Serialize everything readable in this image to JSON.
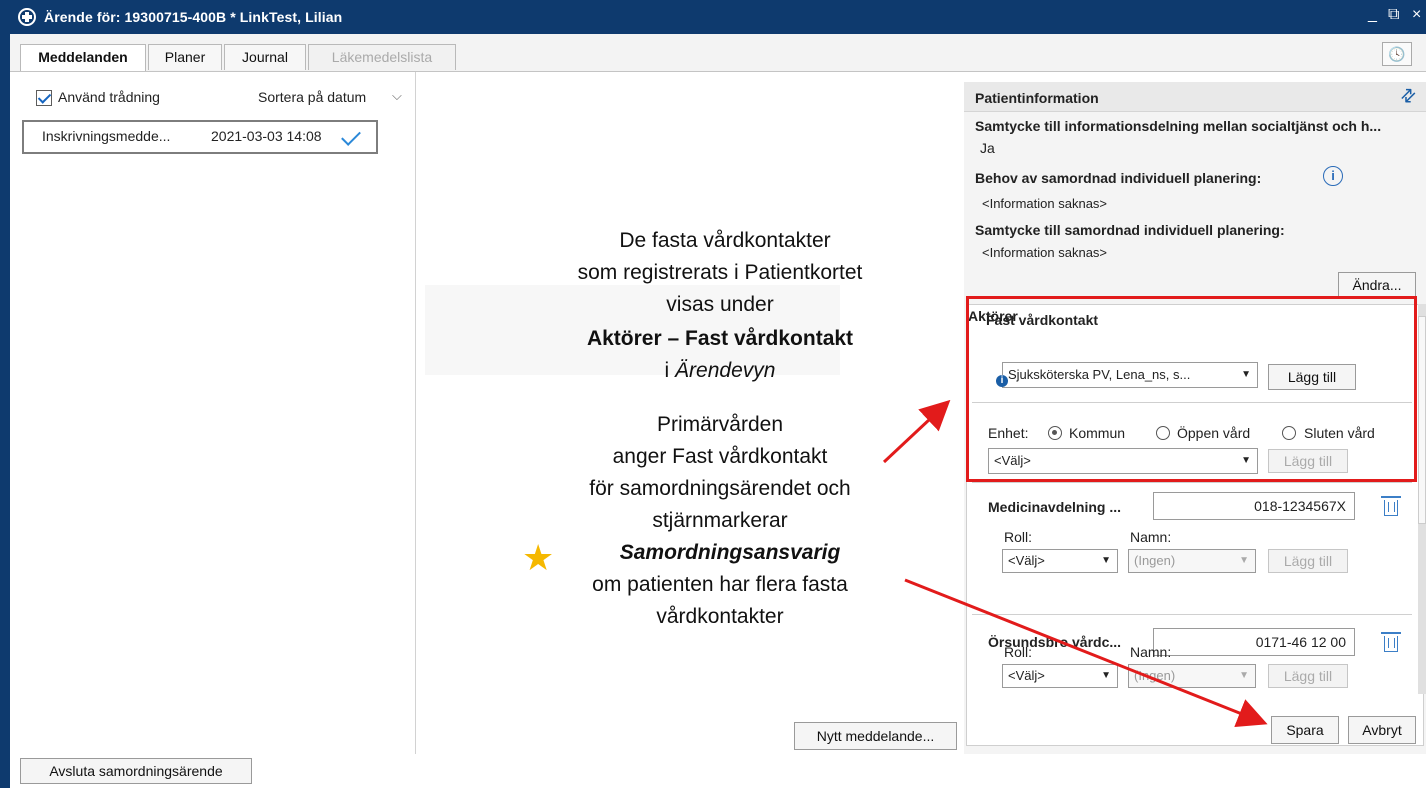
{
  "window": {
    "title": "Ärende för: 19300715-400B * LinkTest, Lilian",
    "controls": {
      "minimize": "_",
      "restore": "⧉",
      "close": "×"
    }
  },
  "tabs": [
    {
      "label": "Meddelanden",
      "state": "active"
    },
    {
      "label": "Planer",
      "state": "normal"
    },
    {
      "label": "Journal",
      "state": "normal"
    },
    {
      "label": "Läkemedelslista",
      "state": "disabled"
    }
  ],
  "messages": {
    "use_threading_label": "Använd trådning",
    "use_threading_checked": true,
    "sort_label": "Sortera på datum",
    "items": [
      {
        "name": "Inskrivningsmedde...",
        "date": "2021-03-03 14:08",
        "read_icon": "checkmark-icon"
      }
    ],
    "new_message_button": "Nytt meddelande...",
    "close_case_button": "Avsluta samordningsärende"
  },
  "annotation": {
    "p1_line1": "De fasta vårdkontakter",
    "p1_line2": "som registrerats i Patientkortet",
    "p1_line3": "visas under",
    "p1_line4": "Aktörer – Fast vårdkontakt",
    "p1_line5a": "i ",
    "p1_line5b": "Ärendevyn",
    "p2_line1": "Primärvården",
    "p2_line2": "anger Fast vårdkontakt",
    "p2_line3": "för samordningsärendet och",
    "p2_line4": "stjärnmarkerar",
    "p2_line5": "Samordningsansvarig",
    "p2_line6": "om patienten har flera fasta",
    "p2_line7": "vårdkontakter",
    "arrow_color": "#e21b1b",
    "star_color": "#f5b800"
  },
  "patient_info": {
    "title": "Patientinformation",
    "consent_sharing_label": "Samtycke till informationsdelning mellan socialtjänst och h...",
    "consent_sharing_value": "Ja",
    "need_sip_label": "Behov av samordnad individuell planering:",
    "need_sip_value": "<Information saknas>",
    "consent_sip_label": "Samtycke till samordnad individuell planering:",
    "consent_sip_value": "<Information saknas>",
    "change_button": "Ändra..."
  },
  "actors": {
    "title": "Aktörer",
    "fast_vardkontakt": {
      "title": "Fast vårdkontakt",
      "selected": "Sjuksköterska PV, Lena_ns, s...",
      "add_button": "Lägg till"
    },
    "unit": {
      "label": "Enhet:",
      "options": [
        "Kommun",
        "Öppen vård",
        "Sluten vård"
      ],
      "selected": "Kommun",
      "select_value": "<Välj>",
      "add_button": "Lägg till"
    },
    "cards": [
      {
        "name": "Medicinavdelning ...",
        "phone": "018-1234567X",
        "role_label": "Roll:",
        "role_value": "<Välj>",
        "name_label": "Namn:",
        "name_value": "(Ingen)",
        "add_button": "Lägg till"
      },
      {
        "name": "Örsundsbro vårdc...",
        "phone": "0171-46 12 00",
        "role_label": "Roll:",
        "role_value": "<Välj>",
        "name_label": "Namn:",
        "name_value": "(Ingen)",
        "add_button": "Lägg till"
      }
    ],
    "save_button": "Spara",
    "cancel_button": "Avbryt",
    "highlight_color": "#e21b1b"
  }
}
